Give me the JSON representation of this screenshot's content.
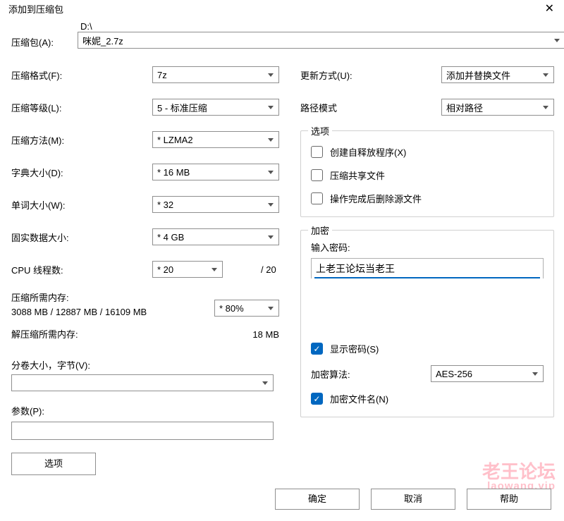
{
  "window": {
    "title": "添加到压缩包",
    "close": "✕"
  },
  "archive": {
    "label": "压缩包(A):",
    "path_hint": "D:\\",
    "filename": "咪妮_2.7z",
    "browse": "..."
  },
  "left": {
    "format_label": "压缩格式(F):",
    "format_value": "7z",
    "level_label": "压缩等级(L):",
    "level_value": "5 - 标准压缩",
    "method_label": "压缩方法(M):",
    "method_value": "* LZMA2",
    "dict_label": "字典大小(D):",
    "dict_value": "* 16 MB",
    "word_label": "单词大小(W):",
    "word_value": "* 32",
    "solid_label": "固实数据大小:",
    "solid_value": "* 4 GB",
    "threads_label": "CPU 线程数:",
    "threads_value": "* 20",
    "threads_total": "/ 20",
    "mem_compress_label": "压缩所需内存:",
    "mem_compress_value": "3088 MB / 12887 MB / 16109 MB",
    "mem_percent": "* 80%",
    "mem_decompress_label": "解压缩所需内存:",
    "mem_decompress_value": "18 MB",
    "split_label": "分卷大小，字节(V):",
    "split_value": "",
    "params_label": "参数(P):",
    "params_value": "",
    "options_btn": "选项"
  },
  "right": {
    "update_label": "更新方式(U):",
    "update_value": "添加并替换文件",
    "pathmode_label": "路径模式",
    "pathmode_value": "相对路径",
    "options_group": "选项",
    "sfx_label": "创建自释放程序(X)",
    "shared_label": "压缩共享文件",
    "delete_after_label": "操作完成后删除源文件",
    "enc_group": "加密",
    "pw_label": "输入密码:",
    "pw_value": "上老王论坛当老王",
    "show_pw_label": "显示密码(S)",
    "algo_label": "加密算法:",
    "algo_value": "AES-256",
    "enc_names_label": "加密文件名(N)"
  },
  "footer": {
    "ok": "确定",
    "cancel": "取消",
    "help": "帮助"
  },
  "watermark": {
    "line1": "老王论坛",
    "line2": "laowang.vip"
  }
}
